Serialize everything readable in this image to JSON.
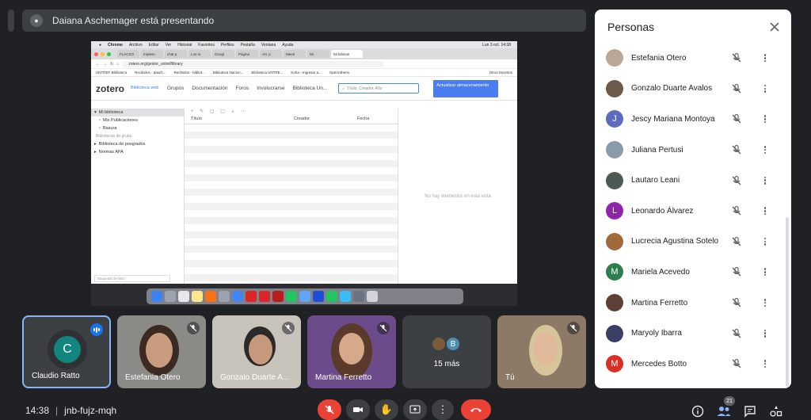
{
  "meeting": {
    "presenting_text": "Daiana Aschemager está presentando",
    "time": "14:38",
    "code": "jnb-fujz-mqh",
    "people_count": "21",
    "separator": "|"
  },
  "shared_screen": {
    "menubar": [
      "Chrome",
      "Archivo",
      "Editar",
      "Ver",
      "Historial",
      "Favoritos",
      "Perfiles",
      "Pestaña",
      "Ventana",
      "Ayuda"
    ],
    "menubar_clock": "Lun 3 oct. 14:38",
    "tabs": [
      "FLACSO",
      "Implem",
      "chat p",
      "Los m",
      "Googl",
      "Página",
      "Art. p",
      "Meeti",
      "Mi",
      "Mi bibliote"
    ],
    "url": "zotero.org/gestor_untref/library",
    "bookmarks": [
      "UNTREF Biblioteca",
      "Recibidos - dasch...",
      "Recibidos - bibliot...",
      "Biblioteca Nacion...",
      "Biblioteca UNTRE...",
      "Koha › Ingresar a...",
      "OpenAthens",
      "Otros favoritos"
    ],
    "zotero": {
      "logo": "zotero",
      "subtitle": "Biblioteca web",
      "nav": [
        "Grupos",
        "Documentación",
        "Foros",
        "Involucrarse",
        "Biblioteca Un..."
      ],
      "search_placeholder": "Título, Creador, Año",
      "update_button": "Actualizar almacenamiento",
      "library_items": [
        "Mi biblioteca",
        "Mis Publicaciones",
        "Basura"
      ],
      "group_header": "Bibliotecas de grupo",
      "group_items": [
        "Biblioteca de posgrados",
        "Normas APA"
      ],
      "filter_placeholder": "Etiquetas de filtro",
      "columns": [
        "Título",
        "Creador",
        "Fecha"
      ],
      "empty_message": "No hay elementos en esta vista"
    }
  },
  "tiles": [
    {
      "name": "Claudio Ratto",
      "initial": "C"
    },
    {
      "name": "Estefania Otero"
    },
    {
      "name": "Gonzalo Duarte A..."
    },
    {
      "name": "Martina Ferretto"
    },
    {
      "name": "15 más",
      "initial": "B"
    },
    {
      "name": "Tú"
    }
  ],
  "people_panel": {
    "title": "Personas",
    "people": [
      {
        "name": "Estefania Otero",
        "avatar": "photo",
        "color": "#b9a79a"
      },
      {
        "name": "Gonzalo Duarte Avalos",
        "avatar": "photo",
        "color": "#6b5a4c"
      },
      {
        "name": "Jescy Mariana Montoya",
        "avatar": "J",
        "color": "#5c6bc0"
      },
      {
        "name": "Juliana Pertusi",
        "avatar": "photo",
        "color": "#8a9aa8"
      },
      {
        "name": "Lautaro Leani",
        "avatar": "photo",
        "color": "#4d5a52"
      },
      {
        "name": "Leonardo Álvarez",
        "avatar": "L",
        "color": "#8e24aa"
      },
      {
        "name": "Lucrecia Agustina Sotelo",
        "avatar": "photo",
        "color": "#a06a3c"
      },
      {
        "name": "Mariela Acevedo",
        "avatar": "M",
        "color": "#2e7d4f"
      },
      {
        "name": "Martina Ferretto",
        "avatar": "photo",
        "color": "#5d4037"
      },
      {
        "name": "Maryoly Ibarra",
        "avatar": "photo",
        "color": "#3a3f66"
      },
      {
        "name": "Mercedes Botto",
        "avatar": "M",
        "color": "#d93025"
      }
    ]
  },
  "colors": {
    "accent": "#8ab4f8",
    "end_call": "#ea4335",
    "panel_bg": "#ffffff"
  }
}
